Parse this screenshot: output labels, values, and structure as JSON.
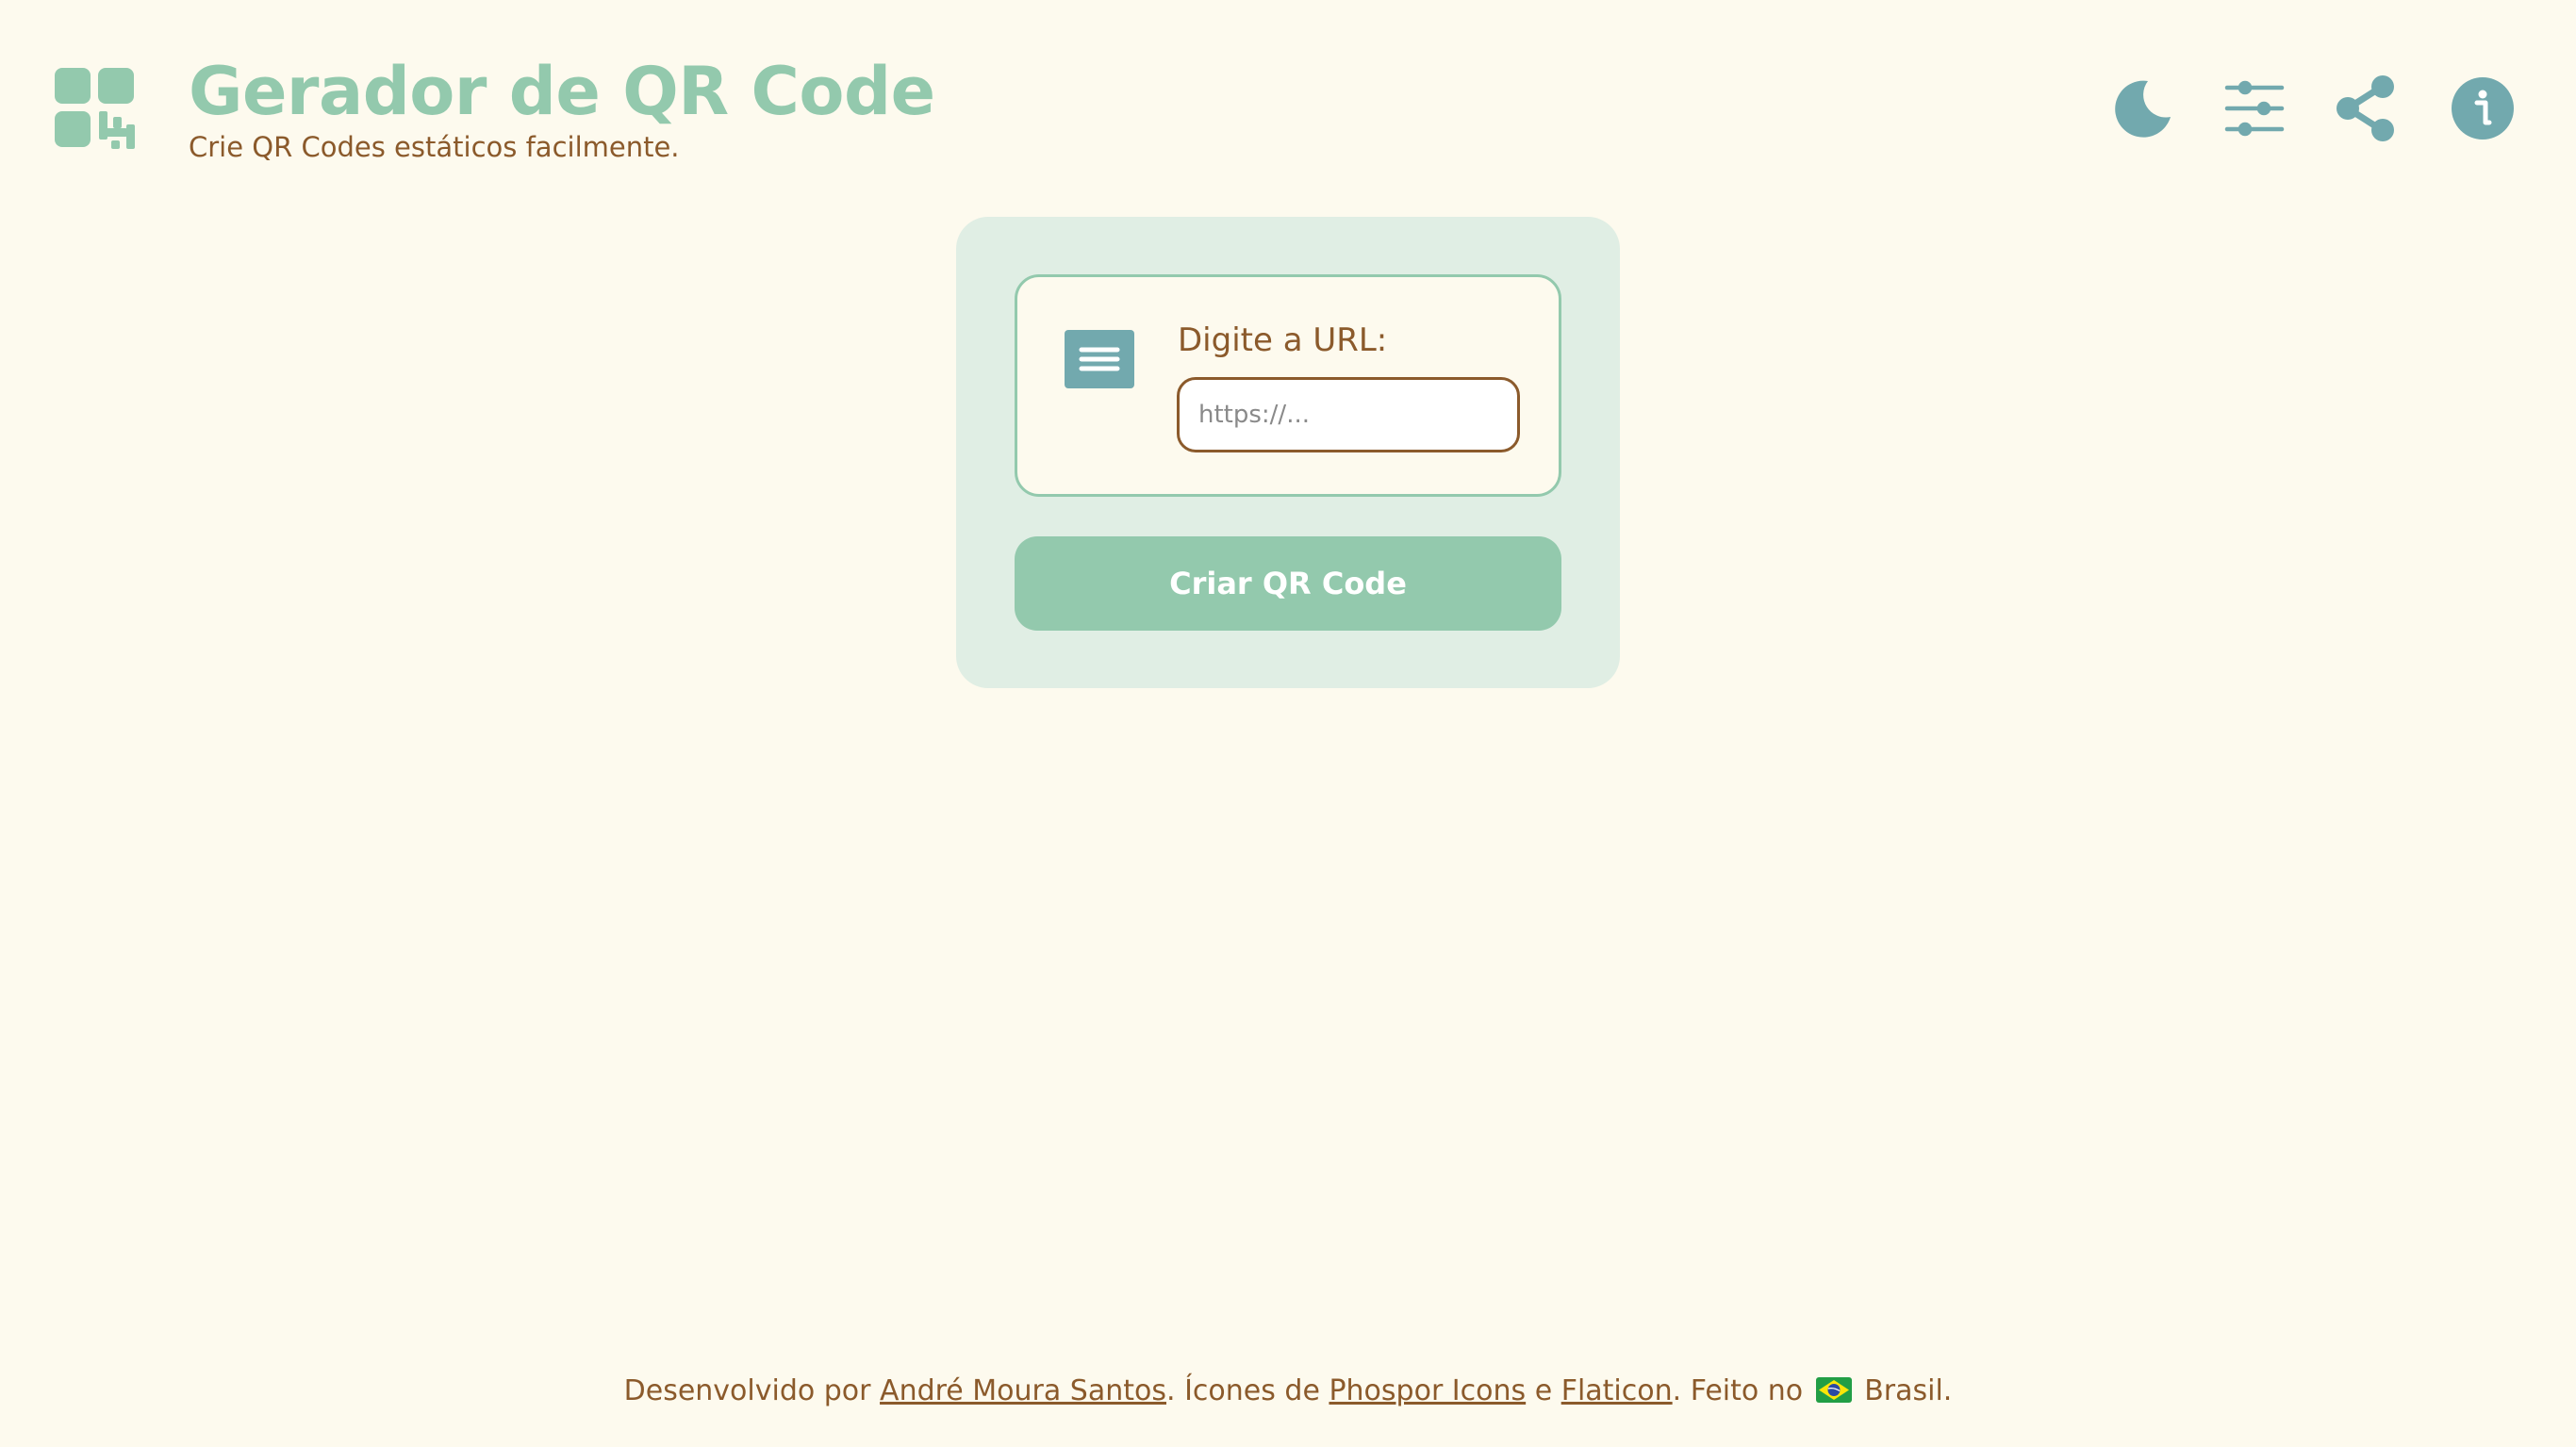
{
  "header": {
    "title": "Gerador de QR Code",
    "subtitle": "Crie QR Codes estáticos facilmente.",
    "logo_icon": "qr-code-icon",
    "toolbar": [
      {
        "name": "theme-toggle",
        "icon": "moon-icon"
      },
      {
        "name": "settings",
        "icon": "sliders-icon"
      },
      {
        "name": "share",
        "icon": "share-icon"
      },
      {
        "name": "info",
        "icon": "info-icon"
      }
    ]
  },
  "form": {
    "type_icon": "text-lines-icon",
    "url_label": "Digite a URL:",
    "url_placeholder": "https://...",
    "url_value": "",
    "submit_label": "Criar QR Code"
  },
  "footer": {
    "prefix": "Desenvolvido por ",
    "author": "André Moura Santos",
    "icons_text": ". Ícones de ",
    "link_phosphor": "Phospor Icons",
    "and": " e ",
    "link_flaticon": "Flaticon",
    "made_in": ". Feito no ",
    "country": " Brasil."
  },
  "colors": {
    "background": "#fdfaee",
    "primary_green": "#93c9ad",
    "card_bg": "#e0eee4",
    "icon_teal": "#72a9ae",
    "text_brown": "#8b5a2b"
  }
}
